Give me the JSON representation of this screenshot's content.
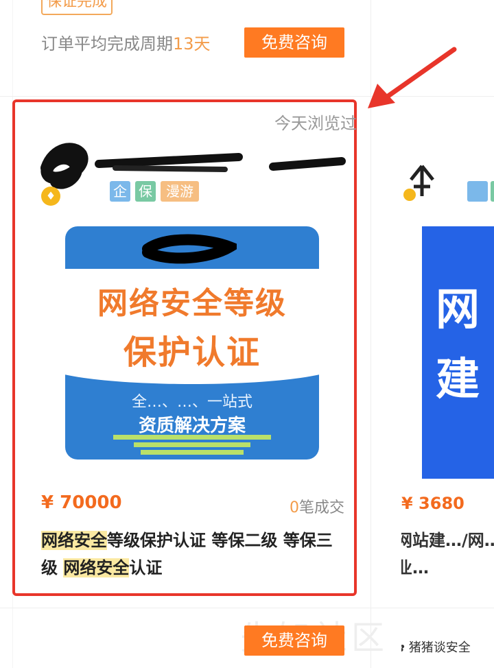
{
  "top_card": {
    "badge": "保证完成",
    "cycle_label": "订单平均完成周期",
    "cycle_value": "13天",
    "consult_button": "免费咨询"
  },
  "card": {
    "viewed_label": "今天浏览过",
    "tags": [
      "企",
      "保",
      "漫游"
    ],
    "image_title_line1": "网络安全等级",
    "image_title_line2": "保护认证",
    "image_sub1": "全…、…、一站式",
    "image_sub2": "资质解决方案",
    "price": "¥ 70000",
    "deals_value": "0",
    "deals_label": "笔成交",
    "title_hl1": "网络安全",
    "title_part1": "等级保护认证 等保二级 等保三级 ",
    "title_hl2": "网络安全",
    "title_part2": "认证"
  },
  "bottom": {
    "consult_button": "免费咨询"
  },
  "side_card": {
    "image_text1": "网",
    "image_text2": "建",
    "price": "¥ 3680",
    "title": "网站建…/网…业…"
  },
  "watermark": "先知社区",
  "wechat_label": "猪猪谈安全",
  "colors": {
    "accent": "#ff7a22",
    "highlight_border": "#e8352a",
    "price": "#f36a1e",
    "image_blue": "#2f7fd1"
  }
}
